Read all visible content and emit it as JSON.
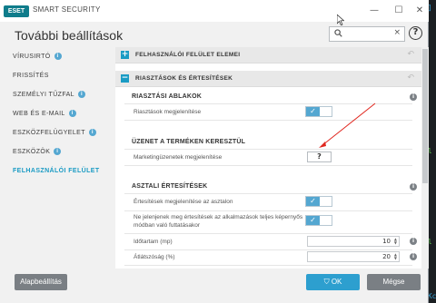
{
  "app": {
    "logo_text": "ESET",
    "title": "SMART SECURITY",
    "page_title": "További beállítások"
  },
  "window_controls": {
    "minimize": "—",
    "maximize": "☐",
    "close": "✕"
  },
  "search": {
    "value": "",
    "placeholder": "",
    "clear": "×"
  },
  "help": "?",
  "sidebar": {
    "items": [
      {
        "label": "VÍRUSIRTÓ",
        "badge": "i",
        "active": false
      },
      {
        "label": "FRISSÍTÉS",
        "badge": "",
        "active": false
      },
      {
        "label": "SZEMÉLYI TŰZFAL",
        "badge": "i",
        "active": false
      },
      {
        "label": "WEB ÉS E-MAIL",
        "badge": "i",
        "active": false
      },
      {
        "label": "ESZKÖZFELÜGYELET",
        "badge": "i",
        "active": false
      },
      {
        "label": "ESZKÖZÖK",
        "badge": "i",
        "active": false
      },
      {
        "label": "FELHASZNÁLÓI FELÜLET",
        "badge": "",
        "active": true
      }
    ],
    "default_button": "Alapbeállítás"
  },
  "content": {
    "sections": [
      {
        "label": "FELHASZNÁLÓI FELÜLET ELEMEI",
        "toggle": "+"
      },
      {
        "label": "RIASZTÁSOK ÉS ÉRTESÍTÉSEK",
        "toggle": "−"
      }
    ],
    "alert_group": {
      "title": "RIASZTÁSI ABLAKOK",
      "row_label": "Riasztások megjelenítése",
      "toggle_on": true
    },
    "status_group": {
      "title": "ÜZENET A TERMÉKEN KERESZTÜL",
      "row_label": "Marketingüzenetek megjelenítése",
      "button": "?"
    },
    "desktop_group": {
      "title": "ASZTALI ÉRTESÍTÉSEK",
      "rows": [
        {
          "label": "Értesítések megjelenítése az asztalon",
          "toggle_on": true
        },
        {
          "label": "Ne jelenjenek meg értesítések az alkalmazások teljes képernyős",
          "label2": "módban való futtatásakor",
          "toggle_on": true
        }
      ],
      "duration": {
        "label": "Időtartam (mp)",
        "value": "10"
      },
      "opacity": {
        "label": "Átlátszóság (%)",
        "value": "20"
      }
    }
  },
  "footer": {
    "ok": "OK",
    "cancel": "Mégse"
  },
  "colors": {
    "accent": "#1a9bc4",
    "toggle_blue": "#54a7d1",
    "ok_blue": "#2d9fcf",
    "gray_btn": "#7a7f84"
  }
}
